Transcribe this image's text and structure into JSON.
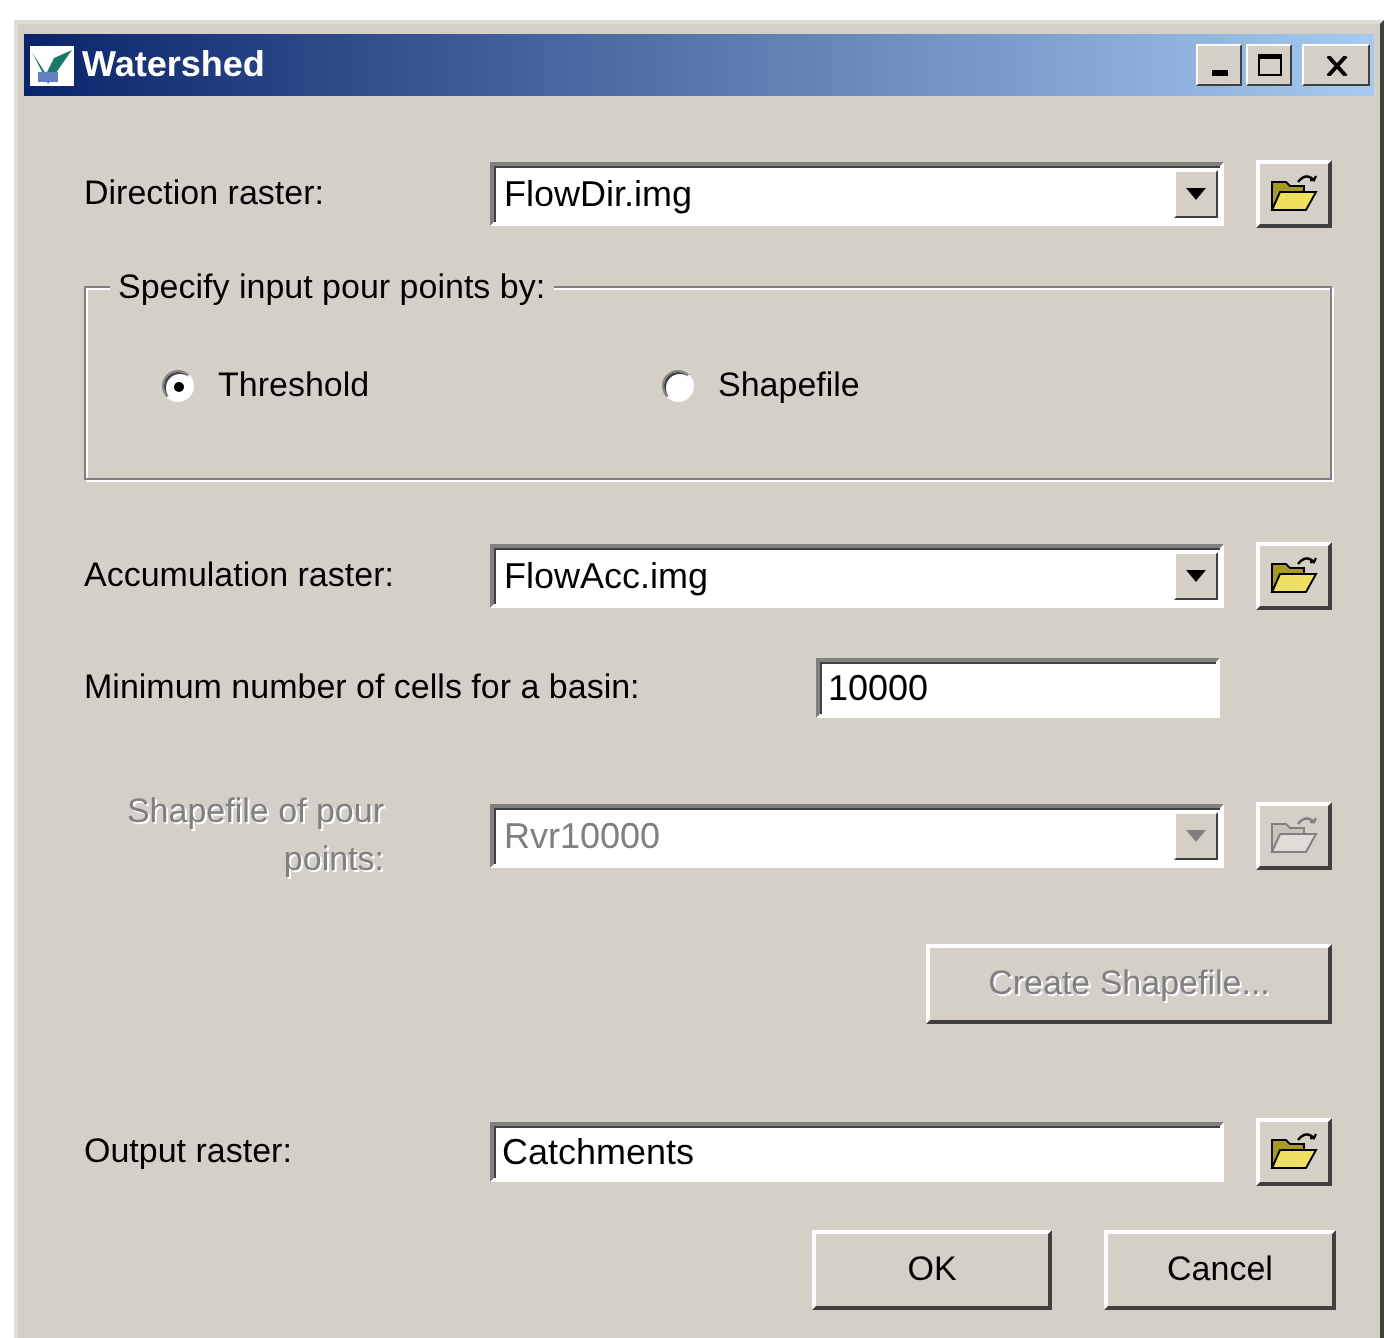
{
  "window": {
    "title": "Watershed"
  },
  "direction_raster": {
    "label": "Direction raster:",
    "value": "FlowDir.img",
    "disabled": false
  },
  "pour_points": {
    "legend": "Specify input pour points by:",
    "options": [
      {
        "label": "Threshold",
        "selected": true
      },
      {
        "label": "Shapefile",
        "selected": false
      }
    ]
  },
  "accumulation_raster": {
    "label": "Accumulation raster:",
    "value": "FlowAcc.img",
    "disabled": false
  },
  "minimum_cells": {
    "label": "Minimum number of cells for a basin:",
    "value": "10000"
  },
  "shapefile": {
    "label": "Shapefile of pour points:",
    "value": "Rvr10000",
    "disabled": true
  },
  "create_button": {
    "label": "Create Shapefile...",
    "disabled": true
  },
  "output_raster": {
    "label": "Output raster:",
    "value": "Catchments",
    "disabled": false
  },
  "buttons": [
    "OK",
    "Cancel"
  ]
}
